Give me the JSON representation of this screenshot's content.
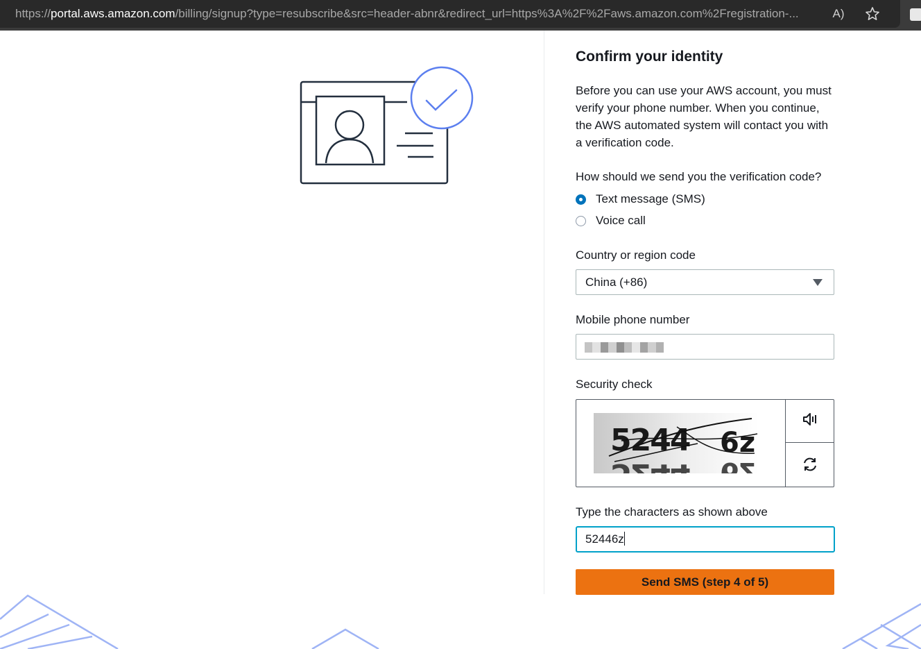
{
  "browser": {
    "url_prefix": "https://",
    "url_host": "portal.aws.amazon.com",
    "url_path": "/billing/signup?type=resubscribe&src=header-abnr&redirect_url=https%3A%2F%2Faws.amazon.com%2Fregistration-...",
    "read_aloud_glyph": "A",
    "icons": [
      "read-aloud-icon",
      "favorite-star-icon",
      "extension-icon"
    ]
  },
  "form": {
    "title": "Confirm your identity",
    "intro": "Before you can use your AWS account, you must verify your phone number. When you continue, the AWS automated system will contact you with a verification code.",
    "method_question": "How should we send you the verification code?",
    "methods": [
      {
        "label": "Text message (SMS)",
        "selected": true
      },
      {
        "label": "Voice call",
        "selected": false
      }
    ],
    "country_label": "Country or region code",
    "country_value": "China (+86)",
    "phone_label": "Mobile phone number",
    "phone_value_redacted": true,
    "security_label": "Security check",
    "captcha_text": [
      "5244",
      "6z"
    ],
    "captcha_answer_label": "Type the characters as shown above",
    "captcha_answer_value": "52446z",
    "submit_label": "Send SMS (step 4 of 5)"
  },
  "colors": {
    "accent_blue": "#0073bb",
    "focus_ring": "#00a1c9",
    "primary_button": "#ec7211",
    "illustration_check": "#5c7fef"
  }
}
